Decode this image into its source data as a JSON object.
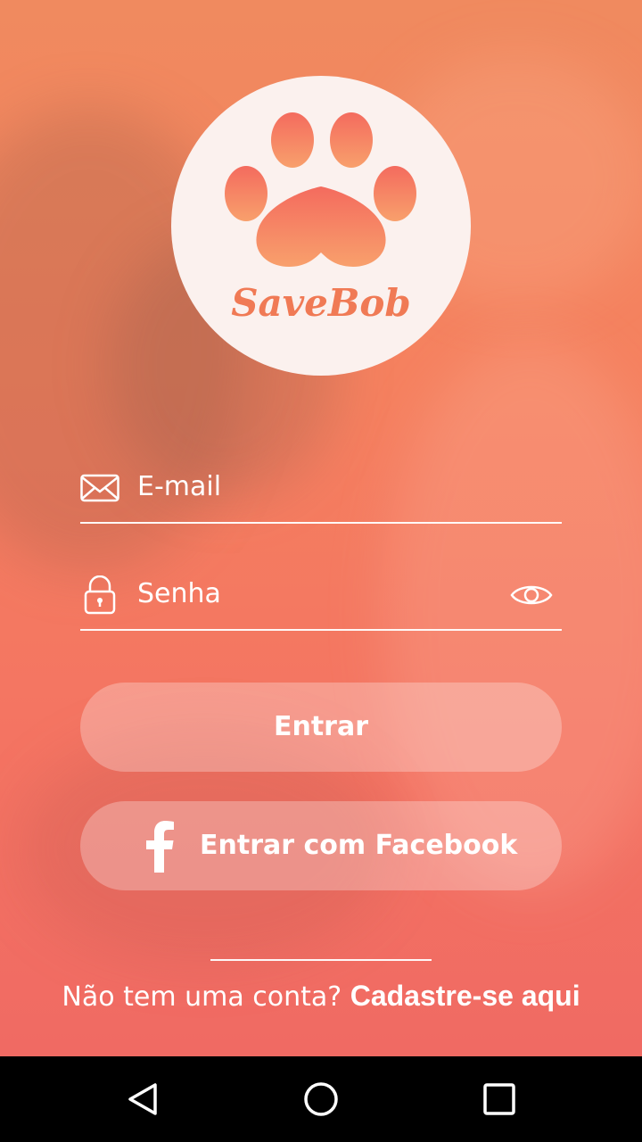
{
  "logo": {
    "brand": "SaveBob",
    "icon": "paw-heart-icon"
  },
  "form": {
    "email_placeholder": "E-mail",
    "email_icon": "envelope-icon",
    "password_placeholder": "Senha",
    "password_icon": "lock-icon",
    "show_password_icon": "eye-icon"
  },
  "buttons": {
    "login_label": "Entrar",
    "facebook_label": "Entrar com Facebook",
    "facebook_icon": "facebook-icon"
  },
  "signup": {
    "prompt": "Não tem uma conta? ",
    "link": "Cadastre-se aqui"
  },
  "navbar": [
    "back-icon",
    "home-icon",
    "recents-icon"
  ],
  "colors": {
    "accent": "#f07a55",
    "background_top": "#f08a5f",
    "background_bottom": "#f06a63"
  }
}
